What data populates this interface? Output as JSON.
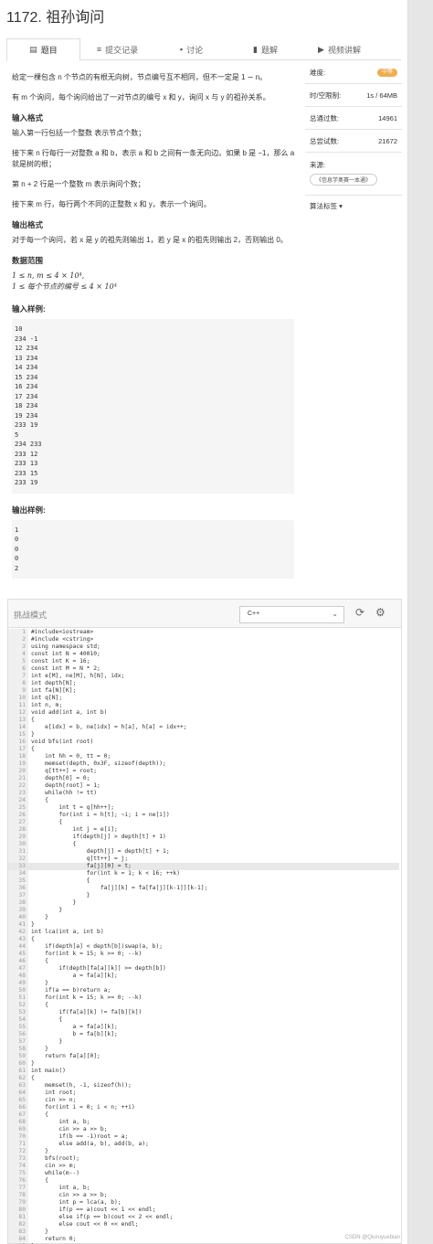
{
  "title": "1172. 祖孙询问",
  "tabs": [
    {
      "label": "题目",
      "icon": "document-icon",
      "glyph": "▤"
    },
    {
      "label": "提交记录",
      "icon": "list-icon",
      "glyph": "≡"
    },
    {
      "label": "讨论",
      "icon": "comment-icon",
      "glyph": "▪"
    },
    {
      "label": "题解",
      "icon": "book-icon",
      "glyph": "▮"
    },
    {
      "label": "视频讲解",
      "icon": "video-icon",
      "glyph": "▶"
    }
  ],
  "problem": {
    "intro1": "给定一棵包含 n 个节点的有根无向树，节点编号互不相同，但不一定是 1 ∼ n。",
    "intro2": "有 m 个询问，每个询问给出了一对节点的编号 x 和 y，询问 x 与 y 的祖孙关系。",
    "input_title": "输入格式",
    "input1": "输入第一行包括一个整数 表示节点个数；",
    "input2": "接下来 n 行每行一对整数 a 和 b，表示 a 和 b 之间有一条无向边。如果 b 是 −1，那么 a 就是树的根；",
    "input3": "第 n + 2 行是一个整数 m 表示询问个数；",
    "input4": "接下来 m 行，每行两个不同的正整数 x 和 y，表示一个询问。",
    "output_title": "输出格式",
    "output1": "对于每一个询问，若 x 是 y 的祖先则输出 1，若 y 是 x 的祖先则输出 2，否则输出 0。",
    "range_title": "数据范围",
    "range1": "1 ≤ n, m ≤ 4 × 10⁴,",
    "range2": "1 ≤ 每个节点的编号 ≤ 4 × 10⁴",
    "sample_in_title": "输入样例:",
    "sample_in": "10\n234 -1\n12 234\n13 234\n14 234\n15 234\n16 234\n17 234\n18 234\n19 234\n233 19\n5\n234 233\n233 12\n233 13\n233 15\n233 19",
    "sample_out_title": "输出样例:",
    "sample_out": "1\n0\n0\n0\n2"
  },
  "side": {
    "difficulty_label": "难度:",
    "difficulty_value": "中等",
    "difficulty_color": "#f0ad4e",
    "time_label": "时/空限制:",
    "time_value": "1s / 64MB",
    "passed_label": "总通过数:",
    "passed_value": "14961",
    "tried_label": "总尝试数:",
    "tried_value": "21672",
    "source_label": "来源:",
    "source_value": "《信息学奥赛一本通》",
    "tags_label": "算法标签 ▾"
  },
  "editor": {
    "mode_label": "挑战模式",
    "language": "C++",
    "lines": [
      "#include<iostream>",
      "#include <cstring>",
      "using namespace std;",
      "const int N = 40010;",
      "const int K = 16;",
      "const int M = N * 2;",
      "int e[M], ne[M], h[N], idx;",
      "int depth[N];",
      "int fa[N][K];",
      "int q[N];",
      "int n, m;",
      "void add(int a, int b)",
      "{",
      "    e[idx] = b, ne[idx] = h[a], h[a] = idx++;",
      "}",
      "void bfs(int root)",
      "{",
      "    int hh = 0, tt = 0;",
      "    memset(depth, 0x3F, sizeof(depth));",
      "    q[tt++] = root;",
      "    depth[0] = 0;",
      "    depth[root] = 1;",
      "    while(hh != tt)",
      "    {",
      "        int t = q[hh++];",
      "        for(int i = h[t]; ~i; i = ne[i])",
      "        {",
      "            int j = e[i];",
      "            if(depth[j] > depth[t] + 1)",
      "            {",
      "                depth[j] = depth[t] + 1;",
      "                q[tt++] = j;",
      "                fa[j][0] = t;",
      "                for(int k = 1; k < 16; ++k)",
      "                {",
      "                    fa[j][k] = fa[fa[j][k-1]][k-1];",
      "                }",
      "            }",
      "        }",
      "    }",
      "}",
      "int lca(int a, int b)",
      "{",
      "    if(depth[a] < depth[b])swap(a, b);",
      "    for(int k = 15; k >= 0; --k)",
      "    {",
      "        if(depth[fa[a][k]] >= depth[b])",
      "            a = fa[a][k];",
      "    }",
      "    if(a == b)return a;",
      "    for(int k = 15; k >= 0; --k)",
      "    {",
      "        if(fa[a][k] != fa[b][k])",
      "        {",
      "            a = fa[a][k];",
      "            b = fa[b][k];",
      "        }",
      "    }",
      "    return fa[a][0];",
      "}",
      "int main()",
      "{",
      "    memset(h, -1, sizeof(h));",
      "    int root;",
      "    cin >> n;",
      "    for(int i = 0; i < n; ++i)",
      "    {",
      "        int a, b;",
      "        cin >> a >> b;",
      "        if(b == -1)root = a;",
      "        else add(a, b), add(b, a);",
      "    }",
      "    bfs(root);",
      "    cin >> m;",
      "    while(m--)",
      "    {",
      "        int a, b;",
      "        cin >> a >> b;",
      "        int p = lca(a, b);",
      "        if(p == a)cout << 1 << endl;",
      "        else if(p == b)cout << 2 << endl;",
      "        else cout << 0 << endl;",
      "    }",
      "    return 0;",
      "}"
    ],
    "highlight_line": 33
  },
  "watermark": "CSDN @Qiuruyuebian"
}
